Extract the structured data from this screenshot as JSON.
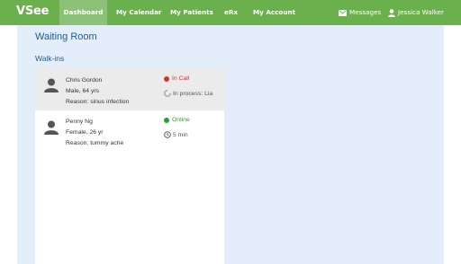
{
  "header": {
    "logo": "VSee",
    "nav": [
      {
        "label": "Dashboard"
      },
      {
        "label": "My Calendar"
      },
      {
        "label": "My Patients"
      },
      {
        "label": "eRx"
      },
      {
        "label": "My Account"
      }
    ],
    "messages_label": "Messages",
    "user_name": "Jessica Walker"
  },
  "page": {
    "title": "Waiting Room",
    "section_title": "Walk-ins"
  },
  "patients": [
    {
      "name": "Chris Gordon",
      "details": "Male, 64 yrs",
      "reason": "Reason: sinus infection",
      "status": "In Call",
      "status_color": "#d63333",
      "sub_status": "In process: Lia",
      "sub_icon": "spinner-icon"
    },
    {
      "name": "Penny Ng",
      "details": "Female, 26 yr",
      "reason": "Reason: tummy ache",
      "status": "Online",
      "status_color": "#2e9e2e",
      "sub_status": "5 min",
      "sub_icon": "clock-icon"
    }
  ],
  "colors": {
    "brand_green": "#6ab04c",
    "active_tab": "#8cc277",
    "content_bg": "#e4eefb",
    "title_blue": "#1d5a99"
  }
}
